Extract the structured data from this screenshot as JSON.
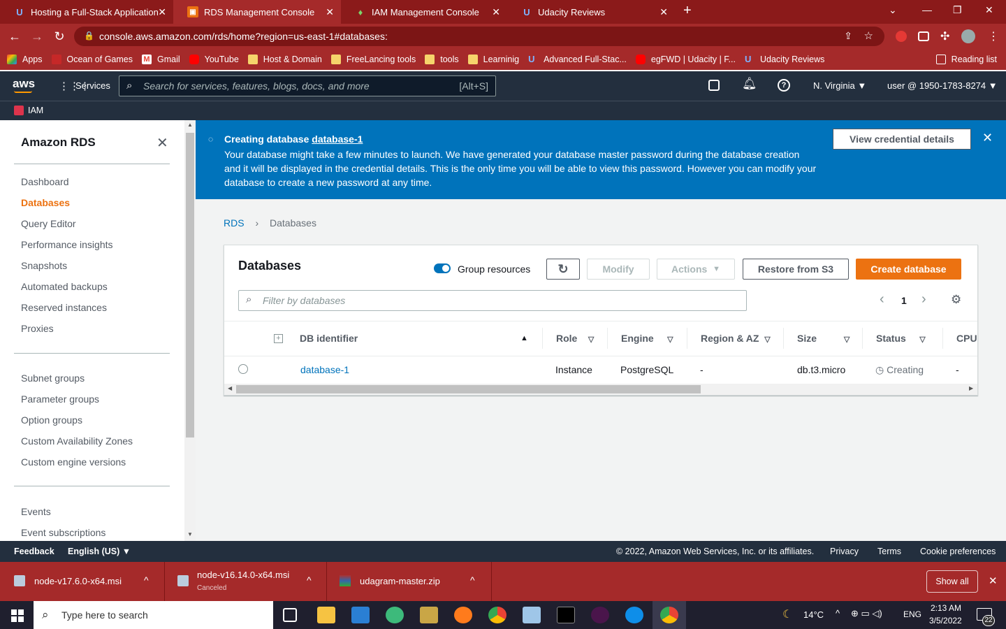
{
  "browser": {
    "tabs": [
      {
        "title": "Hosting a Full-Stack Application"
      },
      {
        "title": "RDS Management Console"
      },
      {
        "title": "IAM Management Console"
      },
      {
        "title": "Udacity Reviews"
      }
    ],
    "url": "console.aws.amazon.com/rds/home?region=us-east-1#databases:",
    "bookmarks": [
      "Apps",
      "Ocean of Games",
      "Gmail",
      "YouTube",
      "Host & Domain",
      "FreeLancing tools",
      "tools",
      "Learninig",
      "Advanced Full-Stac...",
      "egFWD | Udacity | F...",
      "Udacity Reviews"
    ],
    "reading_list": "Reading list"
  },
  "aws_header": {
    "logo": "aws",
    "services": "Services",
    "search_placeholder": "Search for services, features, blogs, docs, and more",
    "search_shortcut": "[Alt+S]",
    "region": "N. Virginia",
    "account": "user @ 1950-1783-8274",
    "pinned": "IAM"
  },
  "sidebar": {
    "title": "Amazon RDS",
    "group1": [
      "Dashboard",
      "Databases",
      "Query Editor",
      "Performance insights",
      "Snapshots",
      "Automated backups",
      "Reserved instances",
      "Proxies"
    ],
    "group2": [
      "Subnet groups",
      "Parameter groups",
      "Option groups",
      "Custom Availability Zones",
      "Custom engine versions"
    ],
    "group3": [
      "Events",
      "Event subscriptions"
    ],
    "active": "Databases"
  },
  "flash": {
    "title_prefix": "Creating database",
    "db_link": "database-1",
    "message": "Your database might take a few minutes to launch. We have generated your database master password during the database creation and it will be displayed in the credential details. This is the only time you will be able to view this password. However you can modify your database to create a new password at any time.",
    "button": "View credential details"
  },
  "breadcrumb": {
    "root": "RDS",
    "current": "Databases"
  },
  "panel": {
    "title": "Databases",
    "group_resources": "Group resources",
    "modify": "Modify",
    "actions": "Actions",
    "restore": "Restore from S3",
    "create": "Create database",
    "filter_placeholder": "Filter by databases",
    "page": "1",
    "columns": [
      "DB identifier",
      "Role",
      "Engine",
      "Region & AZ",
      "Size",
      "Status",
      "CPU"
    ],
    "rows": [
      {
        "id": "database-1",
        "role": "Instance",
        "engine": "PostgreSQL",
        "region": "-",
        "size": "db.t3.micro",
        "status": "Creating",
        "cpu": "-"
      }
    ]
  },
  "footer": {
    "feedback": "Feedback",
    "language": "English (US)",
    "copyright": "© 2022, Amazon Web Services, Inc. or its affiliates.",
    "privacy": "Privacy",
    "terms": "Terms",
    "cookies": "Cookie preferences"
  },
  "downloads": {
    "items": [
      {
        "name": "node-v17.6.0-x64.msi",
        "sub": ""
      },
      {
        "name": "node-v16.14.0-x64.msi",
        "sub": "Canceled"
      },
      {
        "name": "udagram-master.zip",
        "sub": ""
      }
    ],
    "show_all": "Show all"
  },
  "taskbar": {
    "search": "Type here to search",
    "weather": "14°C",
    "lang": "ENG",
    "time": "2:13 AM",
    "date": "3/5/2022",
    "notifications": "22"
  },
  "colors": {
    "accent": "#ec7211",
    "flash": "#0073bb",
    "aws_dark": "#232f3e",
    "chrome": "#a52a2a",
    "link": "#0073bb"
  }
}
